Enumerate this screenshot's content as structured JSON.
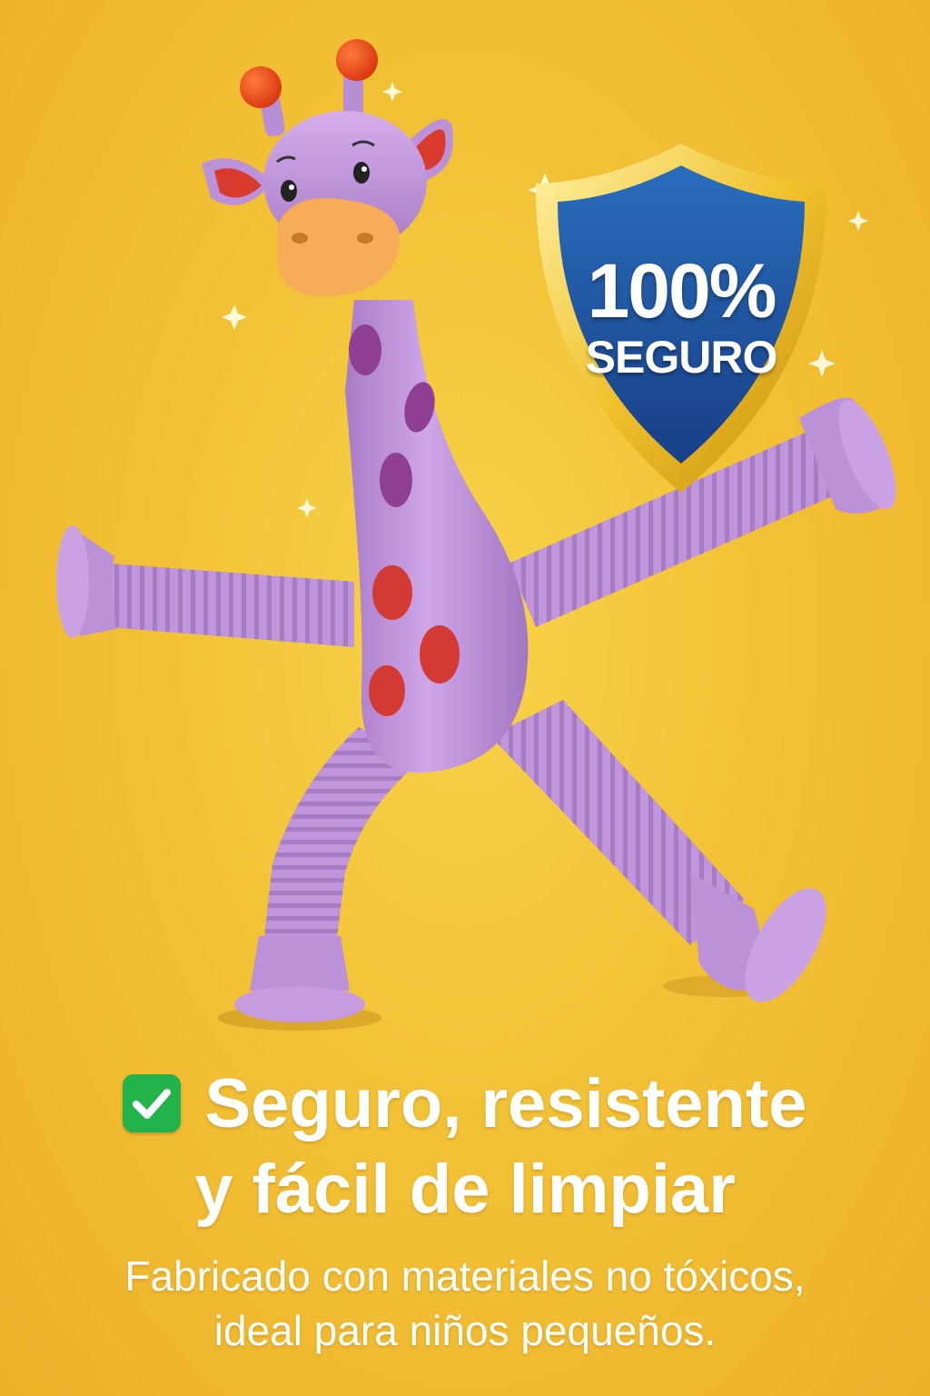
{
  "badge": {
    "percent": "100%",
    "word": "SEGURO",
    "icon": "shield-icon"
  },
  "headline": {
    "line1": "Seguro, resistente",
    "line2": "y fácil de limpiar",
    "icon": "check-icon"
  },
  "subtext": {
    "line1": "Fabricado con materiales no tóxicos,",
    "line2": "ideal para niños pequeños."
  },
  "colors": {
    "background": "#f2c236",
    "toy": "#c79be0",
    "shield": "#1f5aa6",
    "shield_rim": "#f0c22d",
    "check": "#22b34a"
  }
}
